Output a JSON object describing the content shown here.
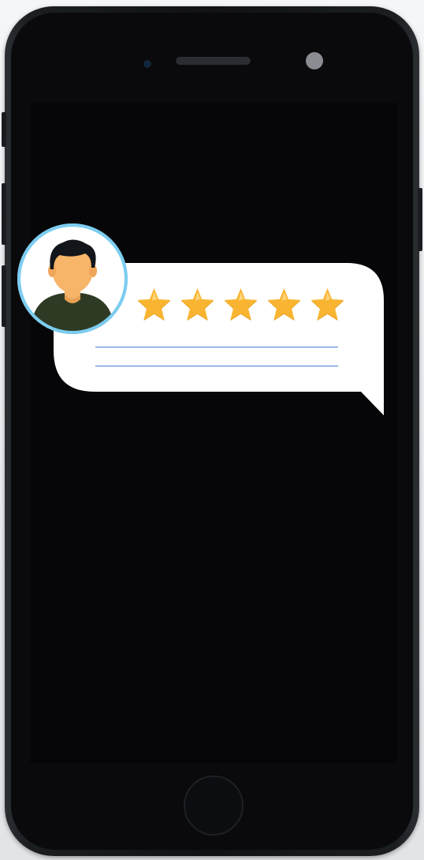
{
  "scene": {
    "device": "smartphone",
    "screen_content": "review-bubble"
  },
  "review": {
    "rating": 5,
    "max_rating": 5,
    "text_lines_count": 2
  },
  "icons": {
    "avatar": "user-avatar-icon",
    "star": "star-icon"
  },
  "colors": {
    "background": "#f2f3f5",
    "phone_body": "#101214",
    "screen": "#060609",
    "bubble": "#ffffff",
    "avatar_ring": "#7ccdf0",
    "star_fill": "#f9b531",
    "star_shadow": "#e89c1c",
    "line": "#4a7fd0",
    "hair": "#121519",
    "skin": "#f6b568",
    "shirt": "#2f3a24"
  }
}
